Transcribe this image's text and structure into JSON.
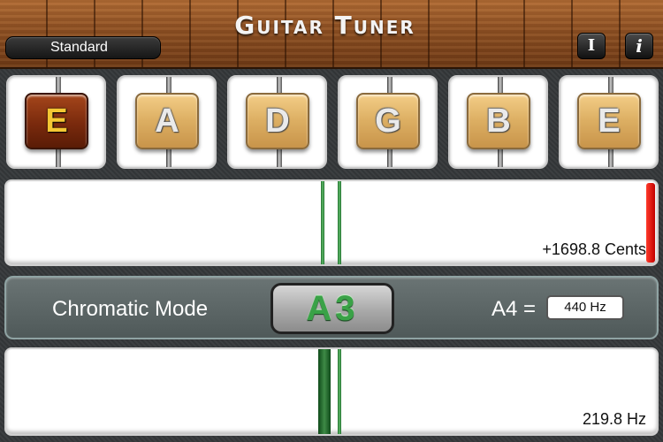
{
  "header": {
    "tuning": "Standard",
    "title": "Guitar Tuner",
    "peg_icon": "tuning-peg-icon",
    "info_icon": "info-icon",
    "info_glyph": "i",
    "peg_glyph": "I"
  },
  "strings": [
    {
      "note": "E",
      "active": true
    },
    {
      "note": "A",
      "active": false
    },
    {
      "note": "D",
      "active": false
    },
    {
      "note": "G",
      "active": false
    },
    {
      "note": "B",
      "active": false
    },
    {
      "note": "E",
      "active": false
    }
  ],
  "cents_meter": {
    "readout": "+1698.8 Cents"
  },
  "mode": {
    "label": "Chromatic Mode",
    "note": "A3",
    "reference_label": "A4 =",
    "reference_value": "440 Hz"
  },
  "hz_meter": {
    "readout": "219.8 Hz"
  },
  "colors": {
    "active_string": "#7a2a0d",
    "needle_green": "#3e8a46",
    "alert_red": "#e00000"
  }
}
